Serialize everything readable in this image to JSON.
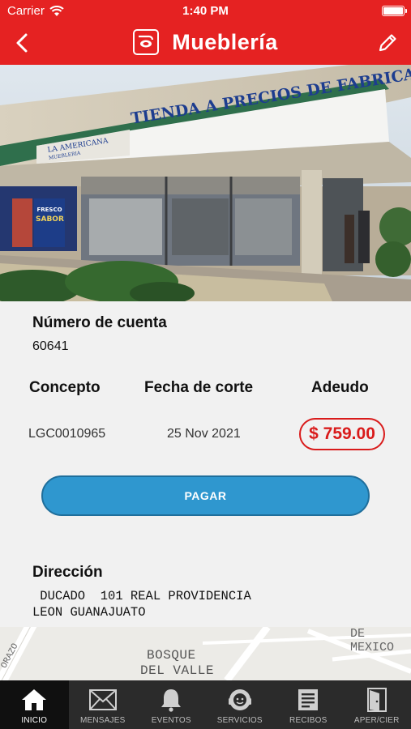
{
  "status_bar": {
    "carrier": "Carrier",
    "time": "1:40 PM"
  },
  "header": {
    "title": "Mueblería"
  },
  "photo": {
    "sign_text": "TIENDA A PRECIOS DE FABRICA",
    "brand_text": "LA AMERICANA",
    "brand_sub": "MUEBLERIA",
    "poster_line1": "FRESCO",
    "poster_line2": "SABOR"
  },
  "account": {
    "label": "Número de cuenta",
    "value": "60641"
  },
  "table": {
    "headers": [
      "Concepto",
      "Fecha de corte",
      "Adeudo"
    ],
    "row": {
      "concepto": "LGC0010965",
      "fecha": "25 Nov 2021",
      "adeudo": "$ 759.00"
    }
  },
  "pay_button": {
    "label": "PAGAR"
  },
  "address": {
    "label": "Dirección",
    "line1": " DUCADO  101 REAL PROVIDENCIA",
    "line2": "LEON GUANAJUATO"
  },
  "map": {
    "label1": "BOSQUE",
    "label2": "DEL VALLE",
    "label3": "DE MEXICO",
    "label4": "ORAZO"
  },
  "tabs": [
    {
      "label": "INICIO",
      "icon": "home-icon",
      "active": true
    },
    {
      "label": "MENSAJES",
      "icon": "envelope-icon",
      "active": false
    },
    {
      "label": "EVENTOS",
      "icon": "bell-icon",
      "active": false
    },
    {
      "label": "SERVICIOS",
      "icon": "support-agent-icon",
      "active": false
    },
    {
      "label": "RECIBOS",
      "icon": "receipt-icon",
      "active": false
    },
    {
      "label": "APER/CIER",
      "icon": "door-icon",
      "active": false
    }
  ],
  "colors": {
    "brand_red": "#e52222",
    "pay_blue": "#2f97cf",
    "amount_red": "#d91b1b",
    "tabbar_bg": "#2b2b2b"
  }
}
